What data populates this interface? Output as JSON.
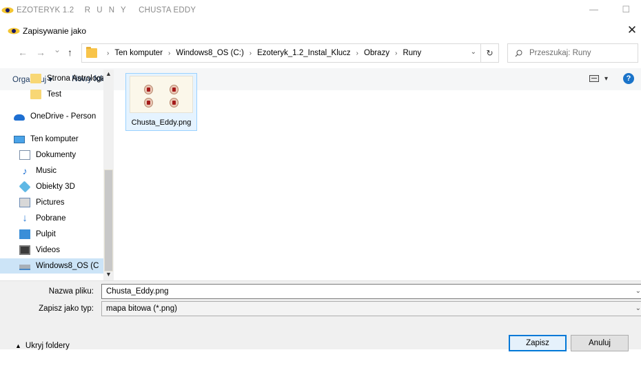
{
  "app": {
    "title_parts": [
      "EZOTERYK 1.2",
      "R U N Y",
      "CHUSTA EDDY"
    ],
    "minimize": "—",
    "maximize": "☐"
  },
  "dialog": {
    "title": "Zapisywanie jako",
    "close": "✕"
  },
  "nav": {
    "back": "←",
    "forward": "→",
    "recent": "⌄",
    "up": "↑",
    "breadcrumb": [
      "Ten komputer",
      "Windows8_OS (C:)",
      "Ezoteryk_1.2_Instal_Klucz",
      "Obrazy",
      "Runy"
    ],
    "breadcrumb_sep": "›",
    "refresh": "↻",
    "search_placeholder": "Przeszukaj: Runy"
  },
  "toolbar": {
    "organize": "Organizuj ▾",
    "new_folder": "Nowy folder",
    "view_dropdown": "▾",
    "help": "?"
  },
  "navpane": {
    "items": [
      {
        "label": "Strona Astrologa",
        "icon": "folder-icon"
      },
      {
        "label": "Test",
        "icon": "folder-icon"
      },
      {
        "label": "OneDrive - Person",
        "icon": "onedrive-icon"
      },
      {
        "label": "Ten komputer",
        "icon": "computer-icon"
      },
      {
        "label": "Dokumenty",
        "icon": "documents-icon"
      },
      {
        "label": "Music",
        "icon": "music-icon"
      },
      {
        "label": "Obiekty 3D",
        "icon": "3d-objects-icon"
      },
      {
        "label": "Pictures",
        "icon": "pictures-icon"
      },
      {
        "label": "Pobrane",
        "icon": "downloads-icon"
      },
      {
        "label": "Pulpit",
        "icon": "desktop-icon"
      },
      {
        "label": "Videos",
        "icon": "videos-icon"
      },
      {
        "label": "Windows8_OS (C",
        "icon": "drive-icon"
      }
    ]
  },
  "files": [
    {
      "name": "Chusta_Eddy.png"
    }
  ],
  "form": {
    "filename_label": "Nazwa pliku:",
    "filename_value": "Chusta_Eddy.png",
    "filetype_label": "Zapisz jako typ:",
    "filetype_value": "mapa bitowa (*.png)",
    "hide_folders": "Ukryj foldery",
    "save": "Zapisz",
    "cancel": "Anuluj"
  }
}
